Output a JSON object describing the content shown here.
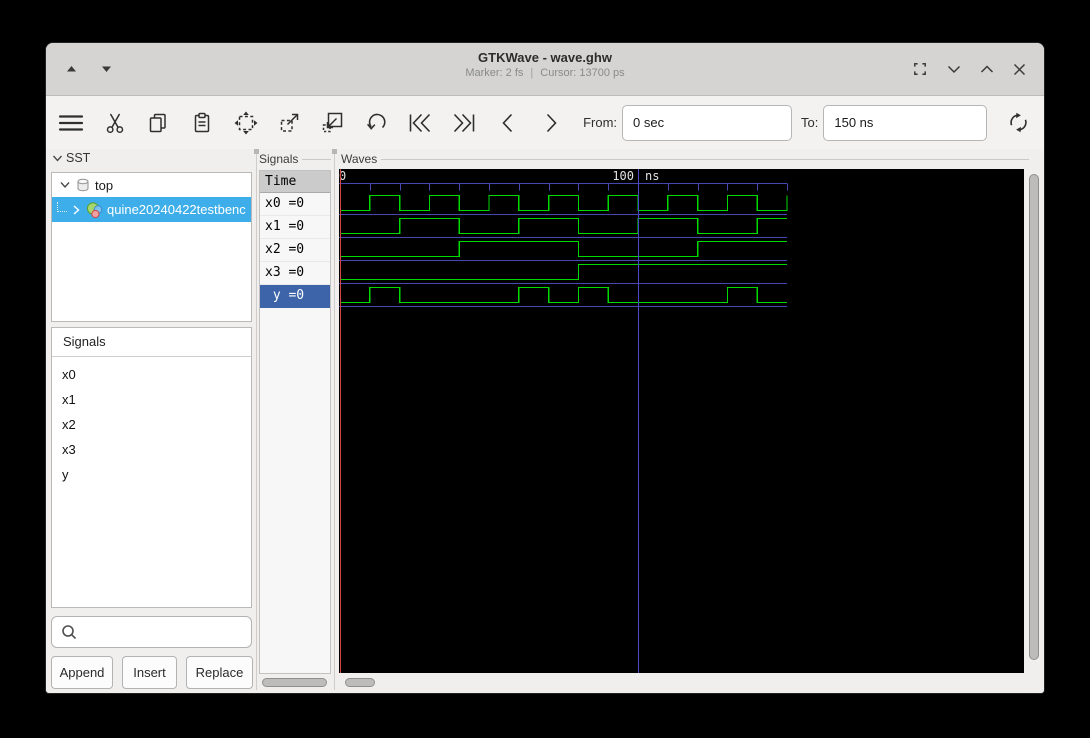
{
  "titlebar": {
    "title": "GTKWave - wave.ghw",
    "marker_status": "Marker: 2 fs",
    "status_separator": "|",
    "cursor_status": "Cursor: 13700 ps"
  },
  "toolbar": {
    "from_label": "From:",
    "from_value": "0 sec",
    "to_label": "To:",
    "to_value": "150 ns",
    "icon_names": [
      "menu",
      "cut",
      "copy",
      "paste",
      "zoom-fit",
      "zoom-in",
      "zoom-out",
      "undo",
      "to-first-edge",
      "to-last-edge",
      "step-left",
      "step-right",
      "reload"
    ]
  },
  "sst": {
    "header": "SST",
    "root_label": "top",
    "child_label": "quine20240422testbenc"
  },
  "facilities": {
    "title": "Signals",
    "items": [
      "x0",
      "x1",
      "x2",
      "x3",
      "y"
    ],
    "buttons": {
      "append": "Append",
      "insert": "Insert",
      "replace": "Replace"
    }
  },
  "signal_list": {
    "frame_label": "Signals",
    "time_header": "Time",
    "rows": [
      {
        "display": "x0 =0",
        "name": "x0",
        "value": "0",
        "selected": false
      },
      {
        "display": "x1 =0",
        "name": "x1",
        "value": "0",
        "selected": false
      },
      {
        "display": "x2 =0",
        "name": "x2",
        "value": "0",
        "selected": false
      },
      {
        "display": "x3 =0",
        "name": "x3",
        "value": "0",
        "selected": false
      },
      {
        "display": " y =0",
        "name": "y",
        "value": "0",
        "selected": true
      }
    ]
  },
  "waves": {
    "frame_label": "Waves",
    "chart_data": {
      "type": "digital-waveform",
      "time_unit": "ns",
      "t_start": 0,
      "t_end": 150,
      "tick_interval_ns": 10,
      "timeline": {
        "start_label": "0",
        "major_tick_label": "100",
        "unit_label": "ns"
      },
      "marker_time_ns": 0,
      "cursor_time_ns": 100,
      "signals": [
        {
          "name": "x0",
          "initial": 0,
          "toggle_times_ns": [
            10,
            20,
            30,
            40,
            50,
            60,
            70,
            80,
            90,
            100,
            110,
            120,
            130,
            140,
            150
          ]
        },
        {
          "name": "x1",
          "initial": 0,
          "toggle_times_ns": [
            20,
            40,
            60,
            80,
            100,
            120,
            140
          ]
        },
        {
          "name": "x2",
          "initial": 0,
          "toggle_times_ns": [
            40,
            80,
            120
          ]
        },
        {
          "name": "x3",
          "initial": 0,
          "toggle_times_ns": [
            80
          ]
        },
        {
          "name": "y",
          "initial": 0,
          "toggle_times_ns": [
            10,
            20,
            60,
            70,
            80,
            90,
            130,
            140
          ]
        }
      ]
    }
  },
  "colors": {
    "wave_signal": "#00d900",
    "wave_grid": "#4747b2",
    "wave_cursor": "#4a4ac8",
    "wave_marker": "#d64545",
    "wave_background": "#000000",
    "wave_text": "#e2e2e2",
    "sst_selection": "#3daee9",
    "row_selection": "#3d64a8"
  }
}
